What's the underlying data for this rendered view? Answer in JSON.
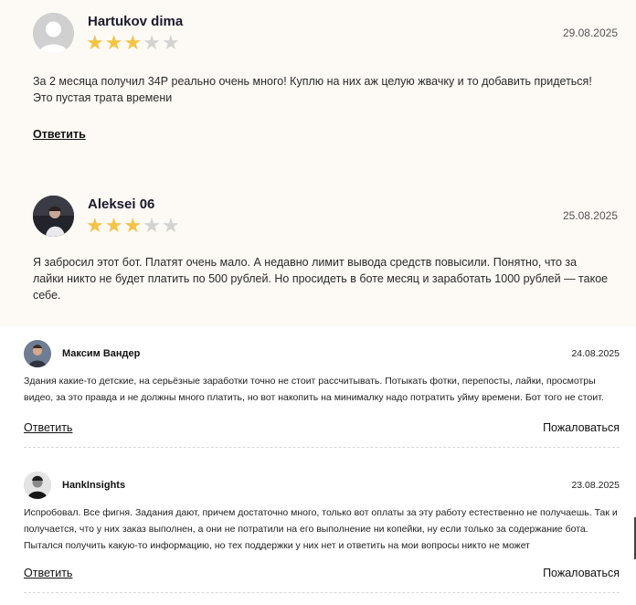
{
  "reviews_featured": [
    {
      "name": "Hartukov dima",
      "date": "29.08.2025",
      "rating": 3,
      "rating_max": 5,
      "text": "За 2 месяца получил 34Р реально очень много! Куплю на них аж целую жвачку и то добавить придеться! Это пустая трата времени",
      "reply_label": "Ответить",
      "avatar": "default-user-icon"
    },
    {
      "name": "Aleksei 06",
      "date": "25.08.2025",
      "rating": 3,
      "rating_max": 5,
      "text": "Я забросил этот бот. Платят очень мало. А недавно лимит вывода средств повысили. Понятно, что за лайки никто не будет платить по 500 рублей. Но просидеть в боте месяц и заработать 1000 рублей — такое себе.",
      "avatar": "user-photo"
    }
  ],
  "reviews_list": [
    {
      "name": "Максим Вандер",
      "date": "24.08.2025",
      "text": "Здания какие-то детские, на серьёзные заработки точно не стоит рассчитывать. Потыкать фотки, перепосты, лайки, просмотры видео, за это правда и не должны много платить, но вот накопить на минималку надо потратить уйму времени. Бот того не стоит.",
      "reply_label": "Ответить",
      "report_label": "Пожаловаться",
      "avatar": "user-photo"
    },
    {
      "name": "HankInsights",
      "date": "23.08.2025",
      "text": "Испробовал. Все фигня. Задания дают, причем достаточно много, только вот оплаты за эту работу естественно не получаешь. Так и получается, что у них заказ выполнен, а они не потратили на его выполнение ни копейки, ну если только за содержание бота. Пытался получить какую-то информацию, но тех поддержки у них нет и ответить на мои вопросы никто не может",
      "reply_label": "Ответить",
      "report_label": "Пожаловаться",
      "avatar": "user-photo"
    }
  ],
  "colors": {
    "star_on": "#f3c445",
    "star_off": "#d3d3d3",
    "featured_bg": "#fdf9f4"
  }
}
